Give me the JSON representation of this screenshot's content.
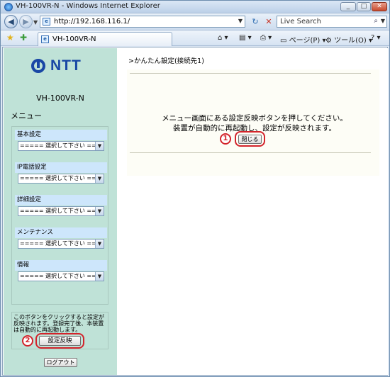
{
  "window": {
    "title": "VH-100VR-N - Windows Internet Explorer",
    "controls": [
      "_",
      "□",
      "✕"
    ]
  },
  "nav": {
    "url": "http://192.168.116.1/",
    "search_placeholder": "Live Search"
  },
  "tabs": [
    {
      "label": "VH-100VR-N"
    }
  ],
  "toolbar": {
    "page_menu": "ページ(P)",
    "tools_menu": "ツール(O)"
  },
  "sidebar": {
    "brand": "NTT",
    "model": "VH-100VR-N",
    "menu_header": "メニュー",
    "groups": [
      {
        "label": "基本設定",
        "selected": "===== 選択して下さい ====="
      },
      {
        "label": "IP電話設定",
        "selected": "===== 選択して下さい ====="
      },
      {
        "label": "詳細設定",
        "selected": "===== 選択して下さい ====="
      },
      {
        "label": "メンテナンス",
        "selected": "===== 選択して下さい ====="
      },
      {
        "label": "情報",
        "selected": "===== 選択して下さい ====="
      }
    ],
    "note": "このボタンをクリックすると設定が反映されます。登録完了後、本装置は自動的に再起動します。",
    "apply_button": "設定反映",
    "logout_button": "ログアウト"
  },
  "main": {
    "breadcrumb": ">かんたん設定(接続先1)",
    "message_line1": "メニュー画面にある設定反映ボタンを押してください。",
    "message_line2": "装置が自動的に再起動し、設定が反映されます。",
    "close_button": "閉じる"
  },
  "callouts": {
    "marker1": "1",
    "marker2": "2"
  },
  "colors": {
    "sidebar_bg": "#bfe2d7",
    "group_header_bg": "#cde6fb",
    "callout": "#d3232b",
    "brand": "#1947a5"
  }
}
